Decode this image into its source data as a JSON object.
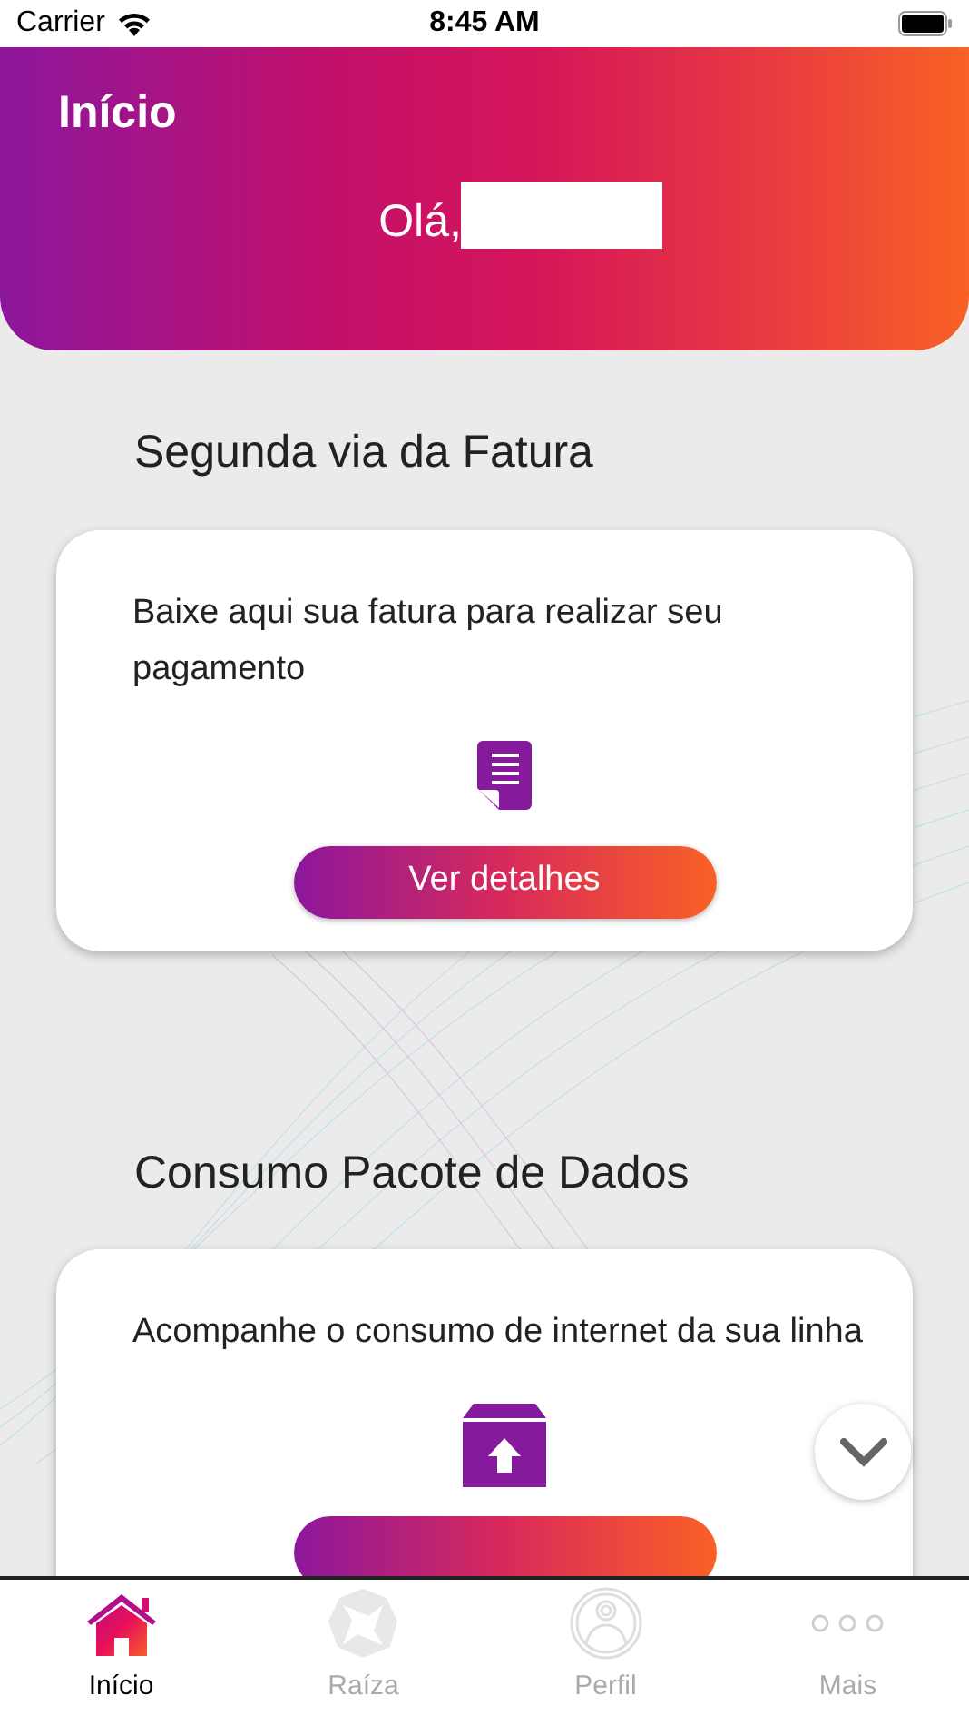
{
  "status_bar": {
    "carrier": "Carrier",
    "time": "8:45 AM"
  },
  "header": {
    "title": "Início",
    "greeting": "Olá,"
  },
  "sections": [
    {
      "title": "Segunda via da Fatura",
      "text": "Baixe aqui sua fatura para realizar seu pagamento",
      "kind": "document",
      "button": "Ver detalhes"
    },
    {
      "title": "Consumo Pacote de Dados",
      "text": "Acompanhe o consumo de internet da sua linha",
      "kind": "package"
    }
  ],
  "tab_bar": [
    {
      "label": "Início",
      "kind": "home",
      "selected": true
    },
    {
      "label": "Raíza",
      "kind": "star",
      "selected": false
    },
    {
      "label": "Perfil",
      "kind": "profile",
      "selected": false
    },
    {
      "label": "Mais",
      "kind": "more",
      "selected": false
    }
  ]
}
